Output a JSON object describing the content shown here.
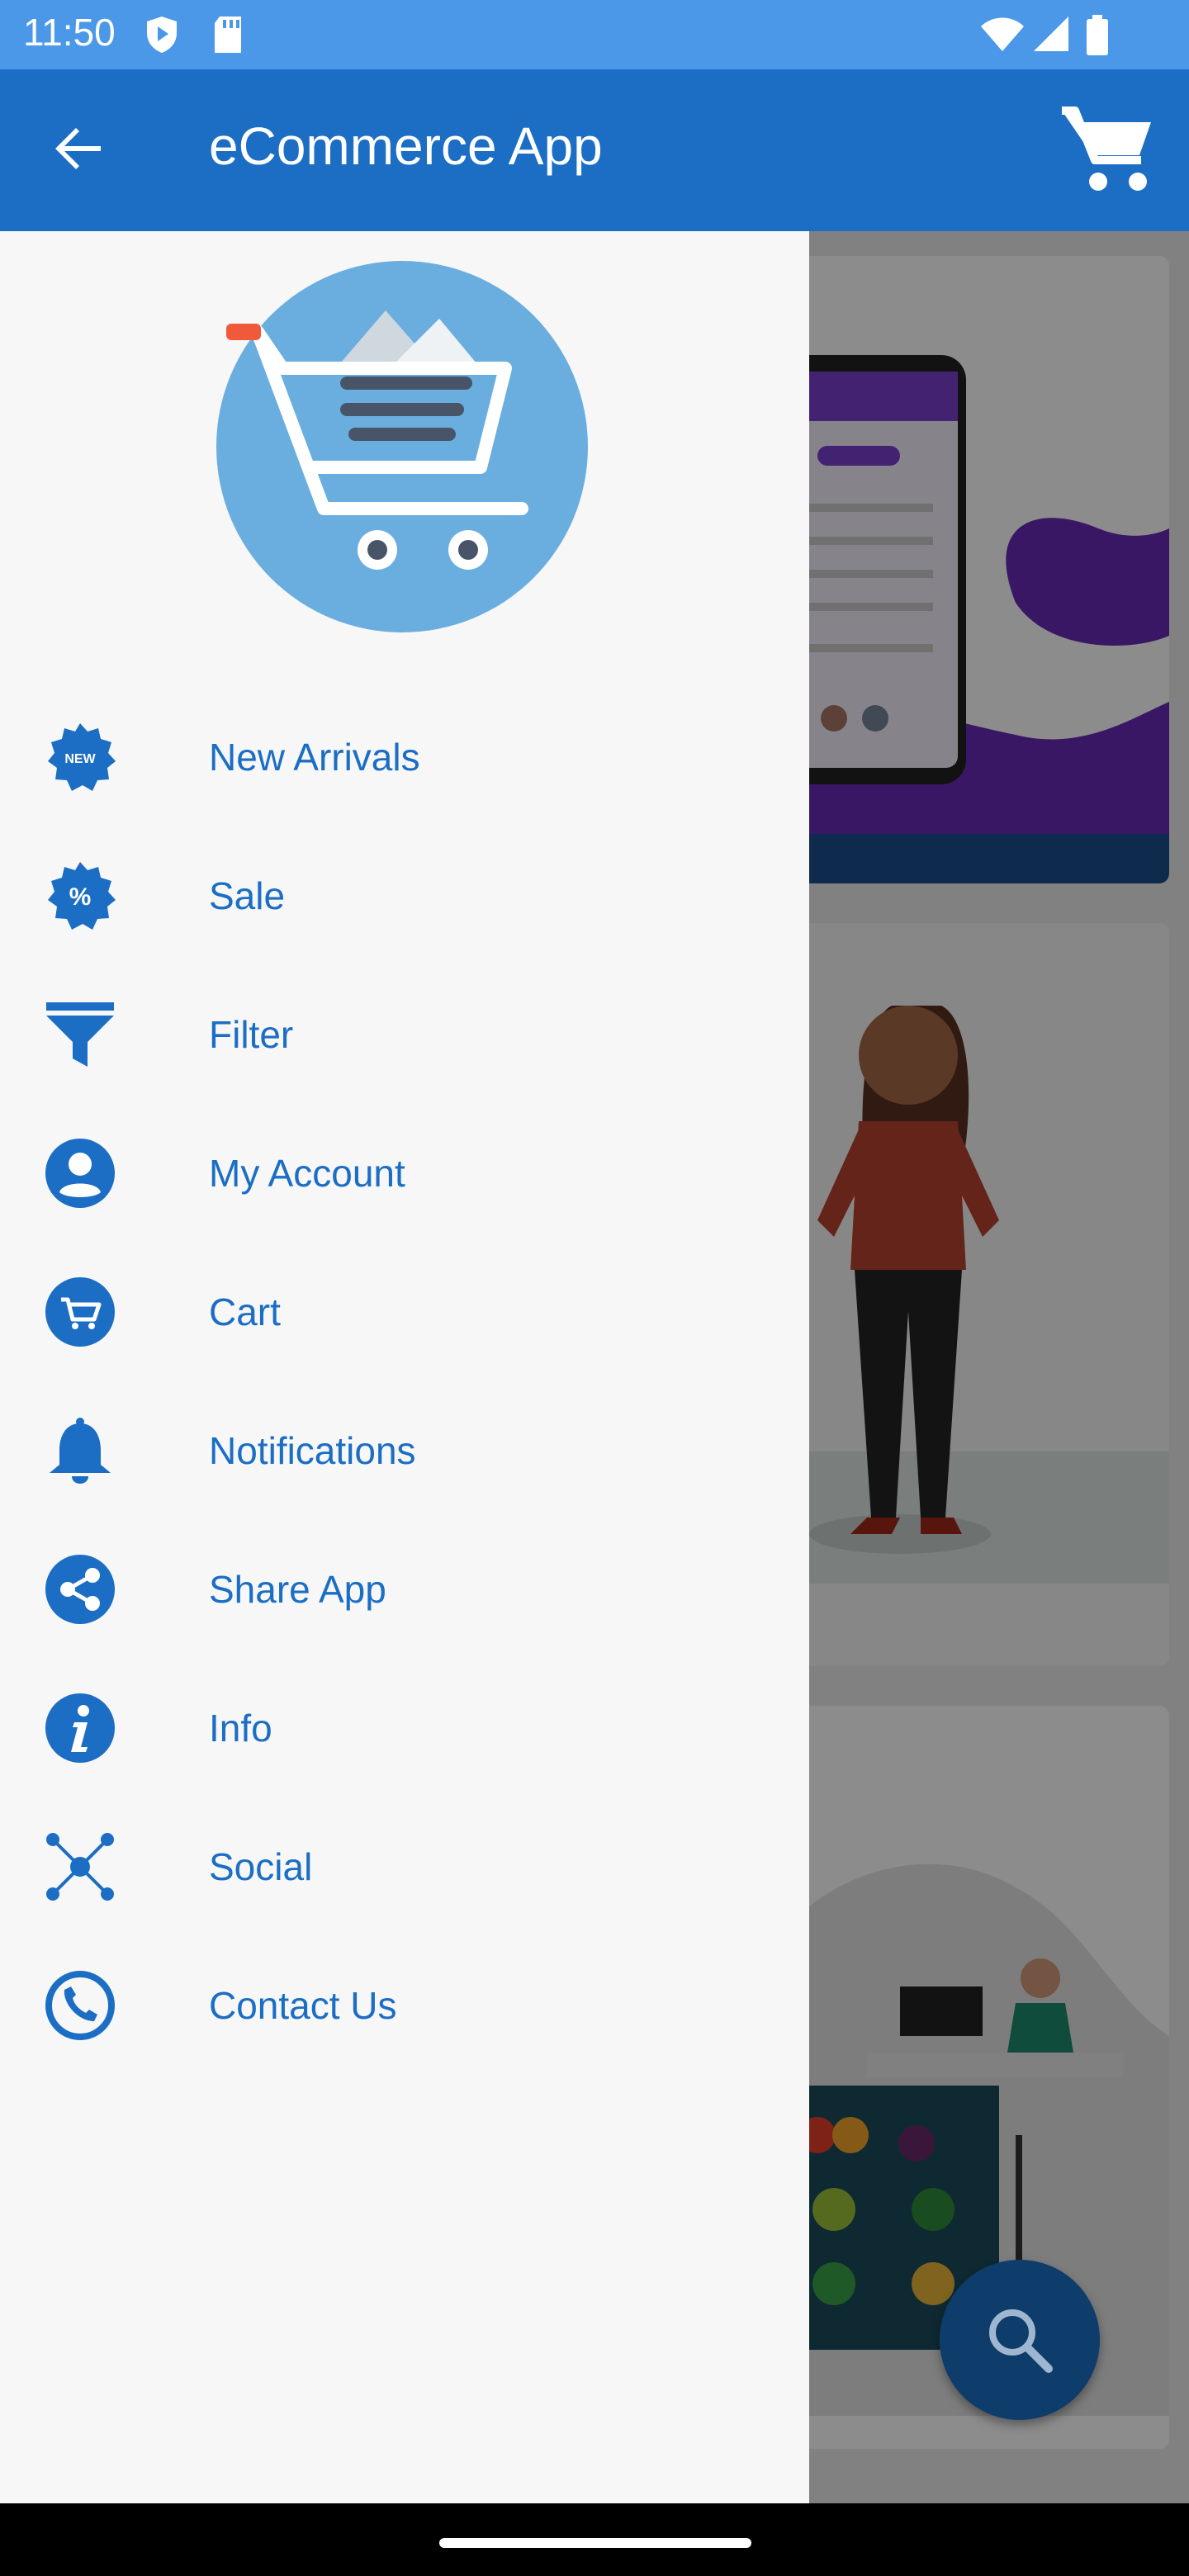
{
  "status_bar": {
    "time": "11:50"
  },
  "app_bar": {
    "title": "eCommerce App"
  },
  "drawer": {
    "items": [
      {
        "label": "New Arrivals",
        "icon": "new-badge-icon"
      },
      {
        "label": "Sale",
        "icon": "percent-badge-icon"
      },
      {
        "label": "Filter",
        "icon": "filter-funnel-icon"
      },
      {
        "label": "My Account",
        "icon": "account-circle-icon"
      },
      {
        "label": "Cart",
        "icon": "cart-circle-icon"
      },
      {
        "label": "Notifications",
        "icon": "bell-icon"
      },
      {
        "label": "Share App",
        "icon": "share-circle-icon"
      },
      {
        "label": "Info",
        "icon": "info-circle-icon"
      },
      {
        "label": "Social",
        "icon": "social-network-icon"
      },
      {
        "label": "Contact Us",
        "icon": "phone-circle-icon"
      }
    ],
    "new_badge_text": "NEW",
    "sale_badge_text": "%"
  },
  "colors": {
    "status_bar": "#4b98e8",
    "app_bar": "#1b6ec4",
    "accent": "#1b6ec4",
    "drawer_bg": "#f7f7f7"
  }
}
